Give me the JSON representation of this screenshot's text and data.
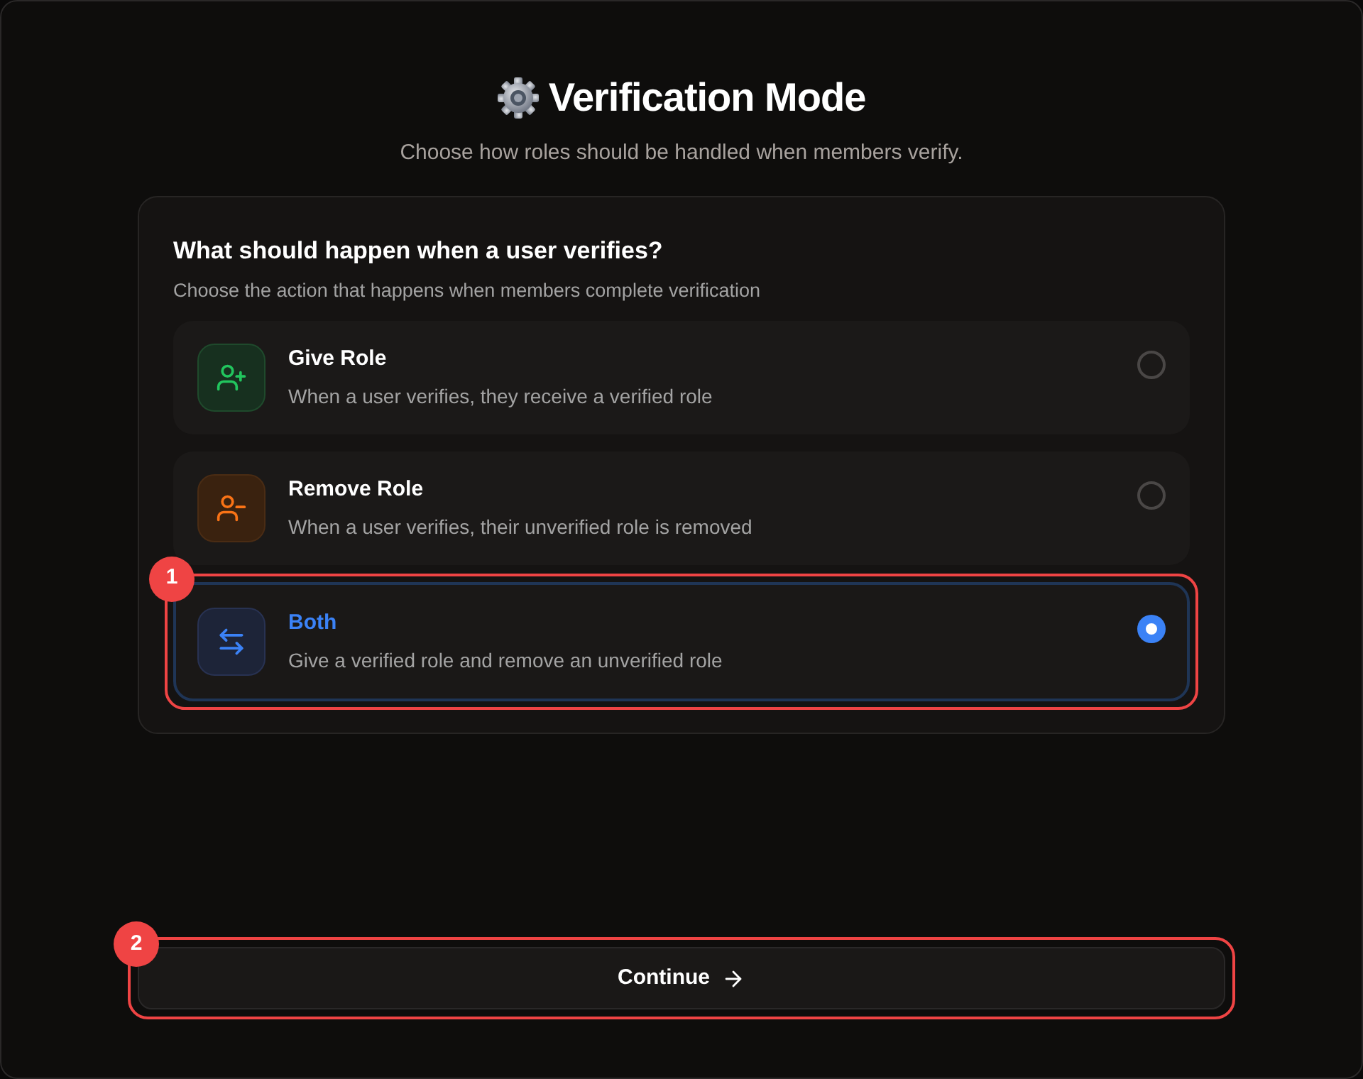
{
  "header": {
    "title": "Verification Mode",
    "subtitle": "Choose how roles should be handled when members verify."
  },
  "question": {
    "title": "What should happen when a user verifies?",
    "subtitle": "Choose the action that happens when members complete verification"
  },
  "options": [
    {
      "kind": "give",
      "title": "Give Role",
      "description": "When a user verifies, they receive a verified role",
      "selected": false
    },
    {
      "kind": "remove",
      "title": "Remove Role",
      "description": "When a user verifies, their unverified role is removed",
      "selected": false
    },
    {
      "kind": "both",
      "title": "Both",
      "description": "Give a verified role and remove an unverified role",
      "selected": true,
      "callout": "1"
    }
  ],
  "continue_button": {
    "label": "Continue",
    "callout": "2"
  }
}
